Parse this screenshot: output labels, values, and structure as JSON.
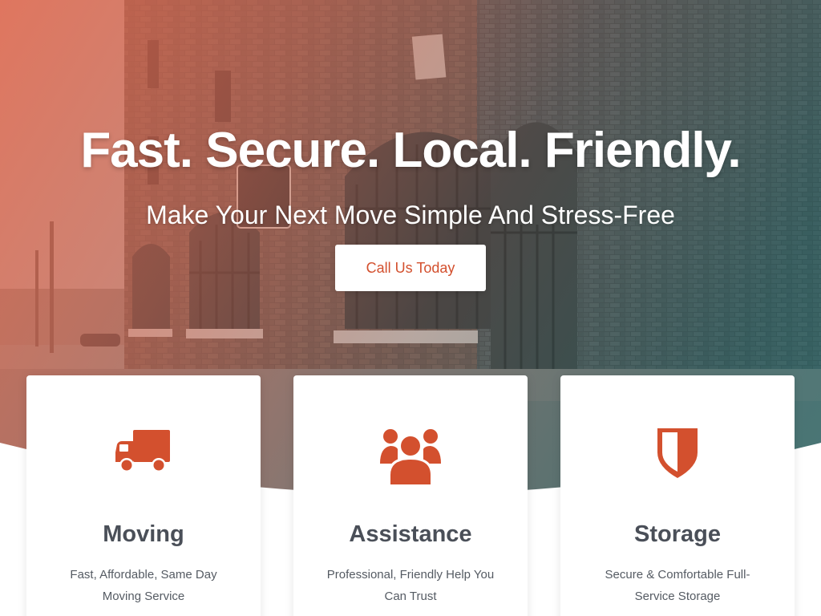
{
  "hero": {
    "title": "Fast. Secure. Local. Friendly.",
    "subtitle": "Make Your Next Move Simple And Stress-Free",
    "cta_label": "Call Us Today"
  },
  "colors": {
    "accent": "#d3502e",
    "heading": "#4a4f58",
    "body_text": "#555b63",
    "card_bg": "#ffffff"
  },
  "services": [
    {
      "icon": "truck-icon",
      "title": "Moving",
      "description": "Fast, Affordable, Same Day Moving Service"
    },
    {
      "icon": "users-icon",
      "title": "Assistance",
      "description": "Professional, Friendly Help You Can Trust"
    },
    {
      "icon": "shield-icon",
      "title": "Storage",
      "description": "Secure & Comfortable Full-Service Storage"
    }
  ]
}
